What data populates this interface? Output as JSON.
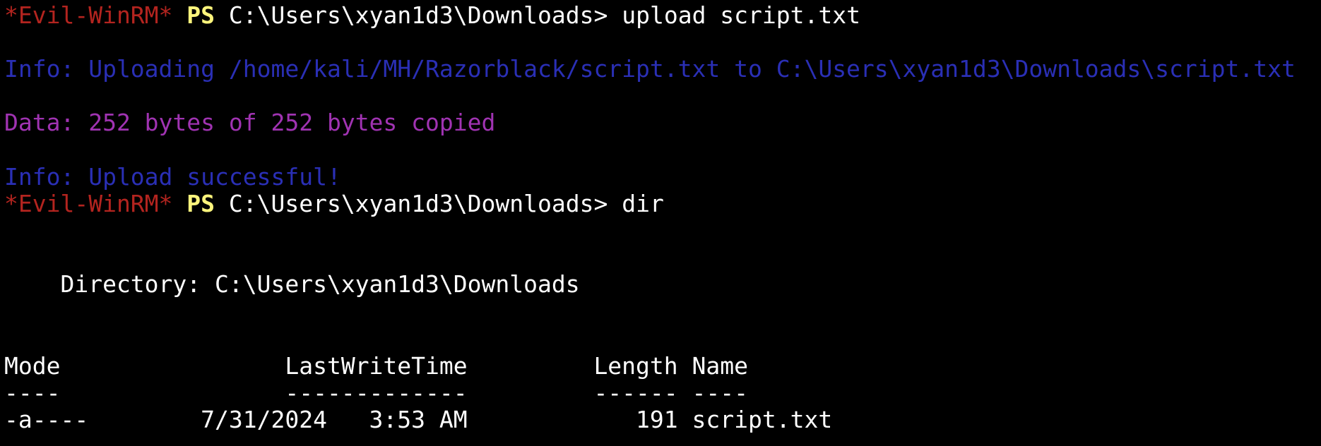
{
  "terminal": {
    "colors": {
      "background": "#000000",
      "prompt_name": "#b3241f",
      "prompt_ps": "#fcf47c",
      "text": "#ffffff",
      "info": "#2a2fb5",
      "data": "#a033b2"
    },
    "prompt": {
      "name": "*Evil-WinRM*",
      "ps": "PS",
      "path": "C:\\Users\\xyan1d3\\Downloads>"
    },
    "commands": [
      " upload script.txt",
      " dir"
    ],
    "messages": {
      "info_uploading": "Info: Uploading /home/kali/MH/Razorblack/script.txt to C:\\Users\\xyan1d3\\Downloads\\script.txt",
      "data_copied": "Data: 252 bytes of 252 bytes copied",
      "info_success": "Info: Upload successful!"
    },
    "directory": {
      "heading": "    Directory: C:\\Users\\xyan1d3\\Downloads",
      "header_row": "Mode                LastWriteTime         Length Name",
      "separator_row": "----                -------------         ------ ----",
      "rows": [
        "-a----        7/31/2024   3:53 AM            191 script.txt"
      ]
    }
  }
}
